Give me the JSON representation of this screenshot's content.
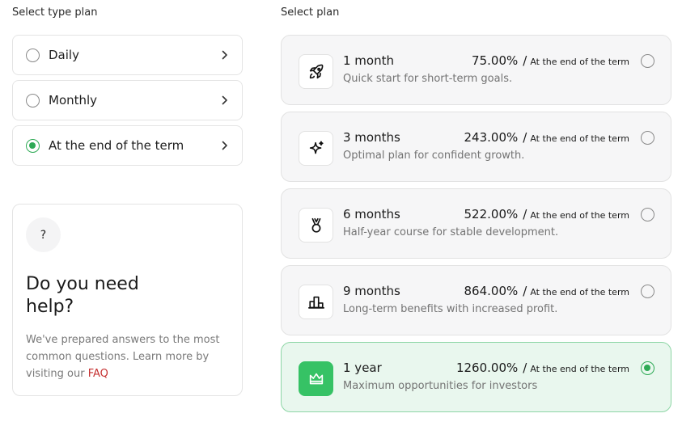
{
  "left_panel": {
    "title": "Select type plan",
    "options": [
      {
        "label": "Daily",
        "checked": false
      },
      {
        "label": "Monthly",
        "checked": false
      },
      {
        "label": "At the end of the term",
        "checked": true
      }
    ]
  },
  "help": {
    "icon_text": "?",
    "title": "Do you need help?",
    "text": "We've prepared answers to the most common questions. Learn more by visiting our ",
    "link": "FAQ"
  },
  "right_panel": {
    "title": "Select plan",
    "plans": [
      {
        "name": "1 month",
        "rate": "75.00%",
        "separator": "/",
        "note": "At the end of the term",
        "desc": "Quick start for short-term goals.",
        "icon": "rocket-icon",
        "selected": false
      },
      {
        "name": "3 months",
        "rate": "243.00%",
        "separator": "/",
        "note": "At the end of the term",
        "desc": "Optimal plan for confident growth.",
        "icon": "sparkle-icon",
        "selected": false
      },
      {
        "name": "6 months",
        "rate": "522.00%",
        "separator": "/",
        "note": "At the end of the term",
        "desc": "Half-year course for stable development.",
        "icon": "medal-icon",
        "selected": false
      },
      {
        "name": "9 months",
        "rate": "864.00%",
        "separator": "/",
        "note": "At the end of the term",
        "desc": "Long-term benefits with increased profit.",
        "icon": "podium-icon",
        "selected": false
      },
      {
        "name": "1 year",
        "rate": "1260.00%",
        "separator": "/",
        "note": "At the end of the term",
        "desc": "Maximum opportunities for investors",
        "icon": "crown-icon",
        "selected": true
      }
    ]
  },
  "colors": {
    "accent": "#36c265",
    "link": "#c53030",
    "selected_bg": "#e9f7ee"
  }
}
